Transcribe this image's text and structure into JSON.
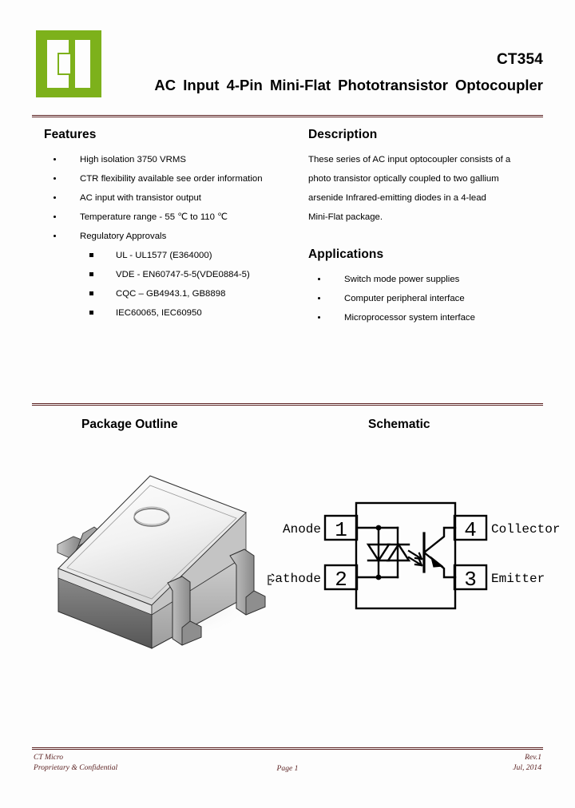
{
  "header": {
    "part_number": "CT354",
    "title": "AC Input 4-Pin Mini-Flat Phototransistor Optocoupler",
    "logo_color": "#7DB11B",
    "logo_name": "ct-micro-logo"
  },
  "rule_color": "#5C2323",
  "features": {
    "heading": "Features",
    "items": [
      "High isolation 3750 VRMS",
      "CTR flexibility available see order information",
      "AC input with transistor output",
      "Temperature range - 55 ℃ to 110 ℃",
      "Regulatory Approvals"
    ],
    "approvals": [
      "UL - UL1577 (E364000)",
      "VDE - EN60747-5-5(VDE0884-5)",
      "CQC – GB4943.1, GB8898",
      "IEC60065, IEC60950"
    ]
  },
  "description": {
    "heading": "Description",
    "lines": [
      "These series of AC input optocoupler consists of a",
      "photo transistor optically coupled to two gallium",
      "arsenide Infrared-emitting diodes in a 4-lead",
      "Mini-Flat package."
    ]
  },
  "applications": {
    "heading": "Applications",
    "items": [
      "Switch mode power supplies",
      "Computer peripheral interface",
      "Microprocessor system interface"
    ]
  },
  "package_outline": {
    "heading": "Package Outline",
    "drawing": "mini-flat-smd-package-3d"
  },
  "schematic": {
    "heading": "Schematic",
    "pins": [
      {
        "number": "1",
        "label": "Anode",
        "side": "left"
      },
      {
        "number": "2",
        "label": "Cathode",
        "side": "left"
      },
      {
        "number": "3",
        "label": "Emitter",
        "side": "right"
      },
      {
        "number": "4",
        "label": "Collector",
        "side": "right"
      }
    ],
    "components": [
      "anti-parallel-led-pair",
      "phototransistor-npn",
      "optical-coupling-arrows"
    ]
  },
  "footer": {
    "company": "CT Micro",
    "confidential": "Proprietary & Confidential",
    "page": "Page 1",
    "revision": "Rev.1",
    "date": "Jul, 2014"
  }
}
